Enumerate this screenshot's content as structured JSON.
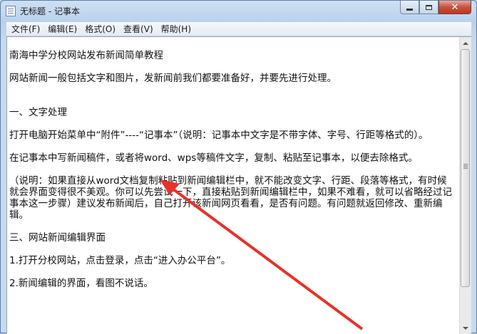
{
  "window": {
    "title": "无标题 - 记事本"
  },
  "controls": {
    "minimize": "minimize",
    "maximize": "maximize",
    "close": "✕"
  },
  "menu": [
    "文件(F)",
    "编辑(E)",
    "格式(O)",
    "查看(V)",
    "帮助(H)"
  ],
  "document": {
    "lines": [
      "南海中学分校网站发布新闻简单教程",
      "网站新闻一般包括文字和图片，发新闻前我们都要准备好，并要先进行处理。",
      "",
      "一、文字处理",
      "打开电脑开始菜单中“附件”----“记事本”（说明：记事本中文字是不带字体、字号、行距等格式的）。",
      "在记事本中写新闻稿件，或者将word、wps等稿件文字，复制、粘贴至记事本，以便去除格式。",
      "（说明：如果直接从word文档复制粘贴到新闻编辑栏中，就不能改变文字、行距、段落等格式，有时候就会界面变得很不美观。你可以先尝试一下，直接粘贴到新闻编辑栏中，如果不难看，就可以省略经过记事本这一步骤）建议发布新闻后，自己打开该新闻网页看看，是否有问题。有问题就返回修改、重新编辑。",
      "三、网站新闻编辑界面",
      "1.打开分校网站，点击登录，点击“进入办公平台”。",
      "2.新闻编辑的界面，看图不说话。"
    ]
  },
  "colors": {
    "annotation_arrow": "#e8312a"
  }
}
